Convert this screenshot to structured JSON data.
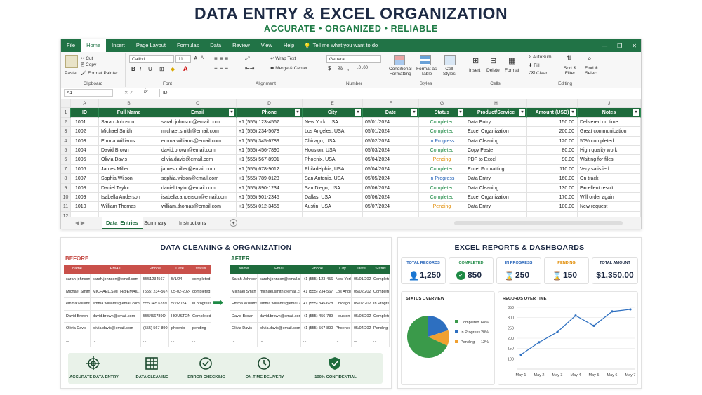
{
  "header": {
    "title": "DATA ENTRY & EXCEL ORGANIZATION",
    "subtitle": "ACCURATE • ORGANIZED • RELIABLE"
  },
  "excel": {
    "menu": [
      "File",
      "Home",
      "Insert",
      "Page Layout",
      "Formulas",
      "Data",
      "Review",
      "View",
      "Help"
    ],
    "tell": "Tell me what you want to do",
    "ribbon": {
      "paste": "Paste",
      "cut": "Cut",
      "copy": "Copy",
      "format_painter": "Format Painter",
      "clipboard": "Clipboard",
      "font_name": "Calibri",
      "font_size": "11",
      "font_grow": "A",
      "font_shrink": "A",
      "bold": "B",
      "italic": "I",
      "underline": "U",
      "font": "Font",
      "wrap": "Wrap Text",
      "merge": "Merge & Center",
      "alignment": "Alignment",
      "number_format": "General",
      "pct": "%",
      "comma": ",",
      "number": "Number",
      "cond1": "Conditional",
      "cond2": "Formatting",
      "fat1": "Format as",
      "fat2": "Table",
      "cs1": "Cell",
      "cs2": "Styles",
      "styles": "Styles",
      "insert": "Insert",
      "delete": "Delete",
      "format": "Format",
      "cells": "Cells",
      "autosum": "AutoSum",
      "fill": "Fill",
      "clear": "Clear",
      "sort1": "Sort &",
      "sort2": "Filter",
      "find1": "Find &",
      "find2": "Select",
      "editing": "Editing"
    },
    "namebox": "A1",
    "fx": "fx",
    "formula": "ID",
    "columns": [
      "A",
      "B",
      "C",
      "D",
      "E",
      "F",
      "G",
      "H",
      "I",
      "J"
    ],
    "headers": [
      "ID",
      "Full Name",
      "Email",
      "Phone",
      "City",
      "Date",
      "Status",
      "Product/Service",
      "Amount (USD)",
      "Notes"
    ],
    "rows": [
      [
        "1001",
        "Sarah Johnson",
        "sarah.johnson@email.com",
        "+1 (555) 123-4567",
        "New York, USA",
        "05/01/2024",
        "Completed",
        "Data Entry",
        "150.00",
        "Delivered on time"
      ],
      [
        "1002",
        "Michael Smith",
        "michael.smith@email.com",
        "+1 (555) 234-5678",
        "Los Angeles, USA",
        "05/01/2024",
        "Completed",
        "Excel Organization",
        "200.00",
        "Great communication"
      ],
      [
        "1003",
        "Emma Williams",
        "emma.williams@email.com",
        "+1 (555) 345-6789",
        "Chicago, USA",
        "05/02/2024",
        "In Progress",
        "Data Cleaning",
        "120.00",
        "50% completed"
      ],
      [
        "1004",
        "David Brown",
        "david.brown@email.com",
        "+1 (555) 456-7890",
        "Houston, USA",
        "05/03/2024",
        "Completed",
        "Copy Paste",
        "80.00",
        "High quality work"
      ],
      [
        "1005",
        "Olivia Davis",
        "olivia.davis@email.com",
        "+1 (555) 567-8901",
        "Phoenix, USA",
        "05/04/2024",
        "Pending",
        "PDF to Excel",
        "90.00",
        "Waiting for files"
      ],
      [
        "1006",
        "James Miller",
        "james.miller@email.com",
        "+1 (555) 678-9012",
        "Philadelphia, USA",
        "05/04/2024",
        "Completed",
        "Excel Formatting",
        "110.00",
        "Very satisfied"
      ],
      [
        "1007",
        "Sophia Wilson",
        "sophia.wilson@email.com",
        "+1 (555) 789-0123",
        "San Antonio, USA",
        "05/05/2024",
        "In Progress",
        "Data Entry",
        "160.00",
        "On track"
      ],
      [
        "1008",
        "Daniel Taylor",
        "daniel.taylor@email.com",
        "+1 (555) 890-1234",
        "San Diego, USA",
        "05/06/2024",
        "Completed",
        "Data Cleaning",
        "130.00",
        "Excellent result"
      ],
      [
        "1009",
        "Isabella Anderson",
        "isabella.anderson@email.com",
        "+1 (555) 901-2345",
        "Dallas, USA",
        "05/06/2024",
        "Completed",
        "Excel Organization",
        "170.00",
        "Will order again"
      ],
      [
        "1010",
        "William Thomas",
        "william.thomas@email.com",
        "+1 (555) 012-3456",
        "Austin, USA",
        "05/07/2024",
        "Pending",
        "Data Entry",
        "100.00",
        "New request"
      ]
    ],
    "sheets": [
      "Data_Entries",
      "Summary",
      "Instructions"
    ],
    "add_sheet": "+"
  },
  "cleaning": {
    "title": "DATA CLEANING & ORGANIZATION",
    "before_label": "BEFORE",
    "after_label": "AFTER",
    "before_headers": [
      "name",
      "EMAIL",
      "Phone",
      "Date",
      "status"
    ],
    "before_rows": [
      [
        "sarah johnson",
        "sarah.johnson@email.com",
        "5551234567",
        "5/1/24",
        "completed"
      ],
      [
        "Michael Smith",
        "MICHAEL.SMITH@EMAIL.COM",
        "(555) 234-5678",
        "05-02-2024",
        "completed"
      ],
      [
        "emma williams",
        "emma.williams@email.com",
        "555.345.6789",
        "5/2/2024",
        "in progress"
      ],
      [
        "David  Brown",
        "david.brown@email.com",
        "555456789O",
        "HOUSTON",
        "Completed"
      ],
      [
        "Olivia Davis",
        "olivia.davis@email.com",
        "(555) 567-8901",
        "phoenix",
        "pending"
      ],
      [
        "...",
        "...",
        "...",
        "...",
        "..."
      ]
    ],
    "after_headers": [
      "Name",
      "Email",
      "Phone",
      "City",
      "Date",
      "Status"
    ],
    "after_rows": [
      [
        "Sarah Johnson",
        "sarah.johnson@email.com",
        "+1 (555) 123-4567",
        "New York",
        "05/01/2024",
        "Completed"
      ],
      [
        "Michael Smith",
        "michael.smith@email.com",
        "+1 (555) 234-5678",
        "Los Angeles",
        "05/02/2024",
        "Completed"
      ],
      [
        "Emma Williams",
        "emma.williams@email.com",
        "+1 (555) 345-6789",
        "Chicago",
        "05/02/2024",
        "In Progress"
      ],
      [
        "David Brown",
        "david.brown@email.com",
        "+1 (555) 456-7890",
        "Houston",
        "05/03/2024",
        "Completed"
      ],
      [
        "Olivia Davis",
        "olivia.davis@email.com",
        "+1 (555) 567-8901",
        "Phoenix",
        "05/04/2024",
        "Pending"
      ],
      [
        "...",
        "...",
        "...",
        "...",
        "...",
        "..."
      ]
    ],
    "features": [
      "ACCURATE DATA ENTRY",
      "DATA CLEANING",
      "ERROR CHECKING",
      "ON-TIME DELIVERY",
      "100% CONFIDENTIAL"
    ]
  },
  "reports": {
    "title": "EXCEL REPORTS & DASHBOARDS",
    "kpis": [
      {
        "label": "TOTAL RECORDS",
        "value": "1,250",
        "color": "#2462b8"
      },
      {
        "label": "COMPLETED",
        "value": "850",
        "color": "#1e8a45"
      },
      {
        "label": "IN PROGRESS",
        "value": "250",
        "color": "#2462b8"
      },
      {
        "label": "PENDING",
        "value": "150",
        "color": "#e08a00"
      },
      {
        "label": "TOTAL AMOUNT",
        "value": "$1,350.00",
        "color": "#1d2a44"
      }
    ],
    "pie_title": "STATUS OVERVIEW",
    "line_title": "RECORDS OVER TIME"
  },
  "chart_data": [
    {
      "type": "pie",
      "title": "STATUS OVERVIEW",
      "categories": [
        "Completed",
        "In Progress",
        "Pending"
      ],
      "values": [
        68,
        20,
        12
      ],
      "labels": [
        "68%",
        "20%",
        "12%"
      ],
      "colors": [
        "#3a9a4a",
        "#2d6fc0",
        "#f0a030"
      ],
      "legend": "right"
    },
    {
      "type": "line",
      "title": "RECORDS OVER TIME",
      "x": [
        "May 1",
        "May 2",
        "May 3",
        "May 4",
        "May 5",
        "May 6",
        "May 7"
      ],
      "y": [
        120,
        180,
        230,
        310,
        260,
        330,
        340
      ],
      "ylim": [
        50,
        350
      ],
      "yticks": [
        100,
        150,
        200,
        250,
        300,
        350
      ],
      "grid": true,
      "color": "#2d6fc0"
    }
  ]
}
